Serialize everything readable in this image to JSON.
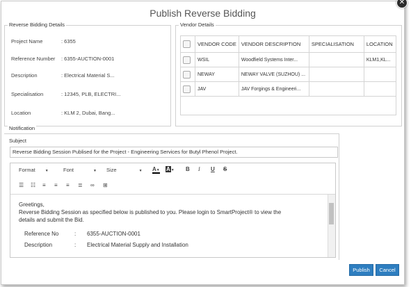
{
  "dialog": {
    "title": "Publish Reverse Bidding",
    "close_glyph": "✕"
  },
  "bidding_details": {
    "legend": "Reverse Bidding Details",
    "rows": [
      {
        "label": "Project Name",
        "value": ": 6355"
      },
      {
        "label": "Reference Number",
        "value": ": 6355-AUCTION-0001"
      },
      {
        "label": "Description",
        "value": ": Electrical Material S..."
      },
      {
        "label": "Specialisation",
        "value": ": 12345, PLB, ELECTRI..."
      },
      {
        "label": "Location",
        "value": ": KLM 2, Dubai, Bang..."
      }
    ]
  },
  "vendor_details": {
    "legend": "Vendor Details",
    "columns": [
      "VENDOR CODE",
      "VENDOR DESCRIPTION",
      "SPECIALISATION",
      "LOCATION"
    ],
    "rows": [
      {
        "code": "WSIL",
        "description": "Woodfield Systems Inter...",
        "specialisation": "",
        "location": "KLM1,KL..."
      },
      {
        "code": "NEWAY",
        "description": "NEWAY VALVE (SUZHOU) ...",
        "specialisation": "",
        "location": ""
      },
      {
        "code": "JAV",
        "description": "JAV Forgings & Engineeri...",
        "specialisation": "",
        "location": ""
      }
    ]
  },
  "notification": {
    "legend": "Notification",
    "subject_label": "Subject",
    "subject_value": "Reverse Bidding Session Publised for the Project - Engineering Services for Butyl Phenol Project.",
    "toolbar": {
      "format": "Format",
      "font": "Font",
      "size": "Size",
      "bold": "B",
      "italic": "I",
      "underline": "U",
      "strike": "S",
      "font_color": "A",
      "bg_color": "A"
    },
    "body": {
      "greeting": "Greetings,",
      "line1": "Reverse Bidding Session as specified below is published to you. Please login to SmartProject® to view the",
      "line2": "details and submit the Bid.",
      "details": [
        {
          "label": "Reference No",
          "sep": ":",
          "value": "6355-AUCTION-0001"
        },
        {
          "label": "Description",
          "sep": ":",
          "value": "Electrical Material Supply and Installation"
        }
      ]
    }
  },
  "buttons": {
    "publish": "Publish",
    "cancel": "Cancel"
  }
}
